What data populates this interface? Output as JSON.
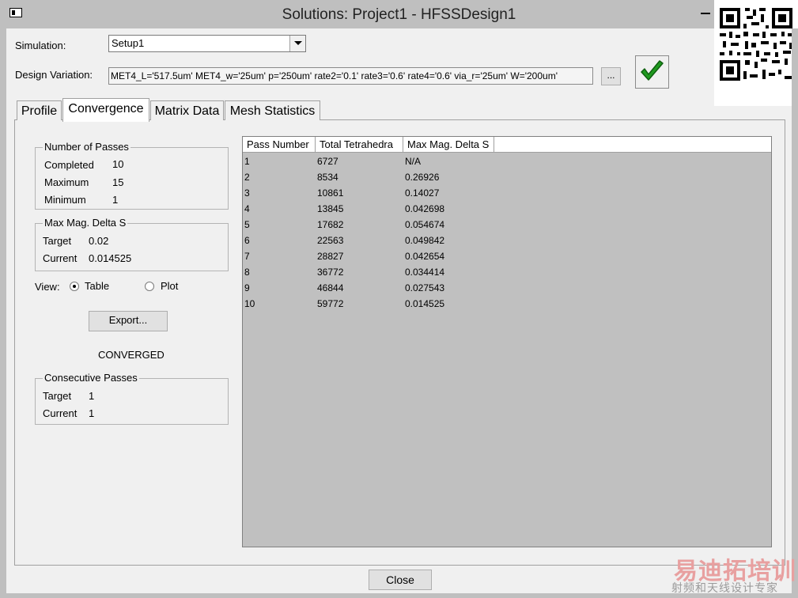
{
  "window": {
    "title": "Solutions: Project1 - HFSSDesign1"
  },
  "simulation": {
    "label": "Simulation:",
    "selected": "Setup1"
  },
  "design_variation": {
    "label": "Design Variation:",
    "value": "MET4_L='517.5um' MET4_w='25um' p='250um' rate2='0.1' rate3='0.6' rate4='0.6' via_r='25um' W='200um'",
    "browse_label": "..."
  },
  "tabs": [
    {
      "label": "Profile"
    },
    {
      "label": "Convergence",
      "active": true
    },
    {
      "label": "Matrix Data"
    },
    {
      "label": "Mesh Statistics"
    }
  ],
  "passes": {
    "title": "Number of Passes",
    "completed_label": "Completed",
    "completed": "10",
    "maximum_label": "Maximum",
    "maximum": "15",
    "minimum_label": "Minimum",
    "minimum": "1"
  },
  "delta": {
    "title": "Max Mag. Delta S",
    "target_label": "Target",
    "target": "0.02",
    "current_label": "Current",
    "current": "0.014525"
  },
  "view": {
    "label": "View:",
    "table_label": "Table",
    "plot_label": "Plot",
    "selected": "Table"
  },
  "export_label": "Export...",
  "status": "CONVERGED",
  "consecutive": {
    "title": "Consecutive Passes",
    "target_label": "Target",
    "target": "1",
    "current_label": "Current",
    "current": "1"
  },
  "table": {
    "headers": [
      "Pass Number",
      "Total Tetrahedra",
      "Max Mag. Delta S"
    ],
    "rows": [
      [
        "1",
        "6727",
        "N/A"
      ],
      [
        "2",
        "8534",
        "0.26926"
      ],
      [
        "3",
        "10861",
        "0.14027"
      ],
      [
        "4",
        "13845",
        "0.042698"
      ],
      [
        "5",
        "17682",
        "0.054674"
      ],
      [
        "6",
        "22563",
        "0.049842"
      ],
      [
        "7",
        "28827",
        "0.042654"
      ],
      [
        "8",
        "36772",
        "0.034414"
      ],
      [
        "9",
        "46844",
        "0.027543"
      ],
      [
        "10",
        "59772",
        "0.014525"
      ]
    ]
  },
  "close_label": "Close",
  "watermark": {
    "main": "易迪拓培训",
    "sub": "射频和天线设计专家"
  },
  "colors": {
    "table_bg": "#c0c0c0",
    "check_green": "#1f9a1f",
    "watermark": "#e8a0a0"
  }
}
